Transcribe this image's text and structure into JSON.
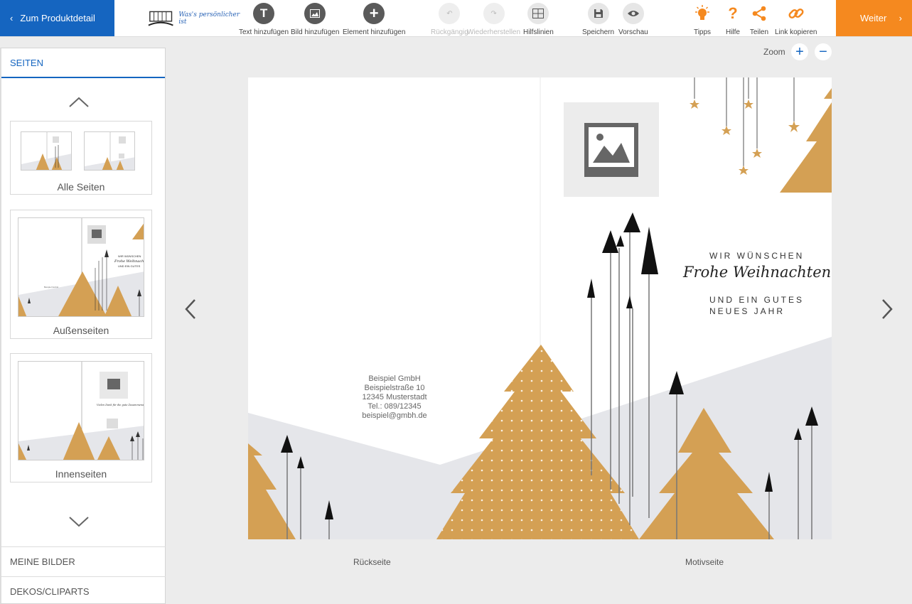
{
  "toolbar": {
    "back_label": "Zum Produktdetail",
    "next_label": "Weiter",
    "logo_text": "Was's persönlicher ist",
    "tools": {
      "text": "Text hinzufügen",
      "image": "Bild hinzufügen",
      "element": "Element hinzufügen",
      "undo": "Rückgängig",
      "redo": "Wiederherstellen",
      "guides": "Hilfslinien",
      "save": "Speichern",
      "preview": "Vorschau",
      "tips": "Tipps",
      "help": "Hilfe",
      "share": "Teilen",
      "copy_link": "Link kopieren"
    }
  },
  "sidebar": {
    "pages_title": "SEITEN",
    "thumbs": {
      "all": "Alle Seiten",
      "outside": "Außenseiten",
      "inside": "Innenseiten"
    },
    "my_images": "MEINE BILDER",
    "decos": "DEKOS/CLIPARTS"
  },
  "zoom": {
    "label": "Zoom"
  },
  "card": {
    "company": [
      "Beispiel GmbH",
      "Beispielstraße 10",
      "12345 Musterstadt",
      "Tel.: 089/12345",
      "beispiel@gmbh.de"
    ],
    "greeting_top": "WIR WÜNSCHEN",
    "greeting_script": "Frohe Weihnachten",
    "greeting_bottom_1": "UND EIN GUTES",
    "greeting_bottom_2": "NEUES JAHR"
  },
  "page_labels": {
    "back": "Rückseite",
    "front": "Motivseite"
  },
  "colors": {
    "blue": "#1565c0",
    "orange": "#f5891f",
    "gold": "#d4a054"
  }
}
